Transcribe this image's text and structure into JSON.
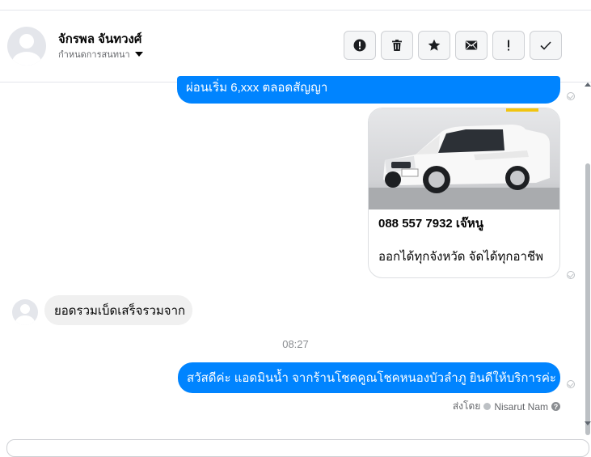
{
  "header": {
    "contact_name": "จักรพล จันทวงศ์",
    "conversation_settings": "กำหนดการสนทนา",
    "actions": [
      {
        "name": "report-button",
        "icon": "alert-circle-icon"
      },
      {
        "name": "delete-button",
        "icon": "trash-icon"
      },
      {
        "name": "star-button",
        "icon": "star-icon"
      },
      {
        "name": "mark-unread-button",
        "icon": "envelope-icon"
      },
      {
        "name": "spam-button",
        "icon": "exclamation-icon"
      },
      {
        "name": "done-button",
        "icon": "check-icon"
      }
    ]
  },
  "messages": {
    "out_1": "ผ่อนเริ่ม 6,xxx ตลอดสัญญา",
    "card": {
      "title": "088 557 7932 เจ๊หนู",
      "description": "ออกได้ทุกจังหวัด จัดได้ทุกอาชีพ",
      "image_icon": "white-pickup-truck-photo"
    },
    "in_1": "ยอดรวมเบ็ดเสร็จรวมจาก",
    "timestamp": "08:27",
    "out_2": "สวัสดีค่ะ แอดมินน้ำ จากร้านโชคคูณโชคหนองบัวลำภู ยินดีให้บริการค่ะ",
    "sent_by_label": "ส่งโดย",
    "sent_by_name": "Nisarut Nam"
  },
  "colors": {
    "accent": "#0084ff",
    "incoming_bubble": "#f0f0f0",
    "muted_text": "#65676b"
  }
}
